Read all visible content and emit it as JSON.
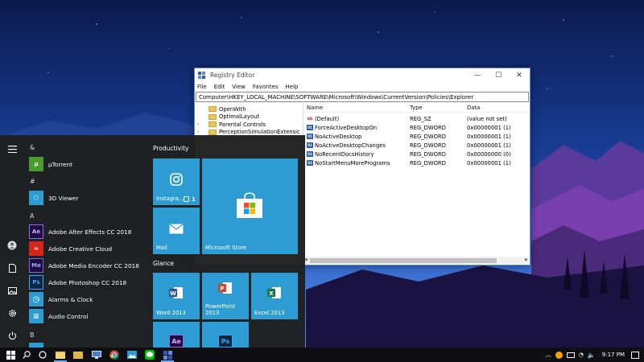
{
  "registry_editor": {
    "title": "Registry Editor",
    "menu": [
      "File",
      "Edit",
      "View",
      "Favorites",
      "Help"
    ],
    "address": "Computer\\HKEY_LOCAL_MACHINE\\SOFTWARE\\Microsoft\\Windows\\CurrentVersion\\Policies\\Explorer",
    "tree": [
      {
        "label": "OpenWith",
        "expandable": false
      },
      {
        "label": "OptimalLayout",
        "expandable": false
      },
      {
        "label": "Parental Controls",
        "expandable": true
      },
      {
        "label": "PerceptionSimulationExtensic",
        "expandable": true
      }
    ],
    "columns": {
      "name": "Name",
      "type": "Type",
      "data": "Data"
    },
    "values": [
      {
        "name": "(Default)",
        "type": "REG_SZ",
        "data": "(value not set)",
        "kind": "sz"
      },
      {
        "name": "ForceActiveDesktopOn",
        "type": "REG_DWORD",
        "data": "0x00000001 (1)",
        "kind": "dword"
      },
      {
        "name": "NoActiveDesktop",
        "type": "REG_DWORD",
        "data": "0x00000001 (1)",
        "kind": "dword"
      },
      {
        "name": "NoActiveDesktopChanges",
        "type": "REG_DWORD",
        "data": "0x00000001 (1)",
        "kind": "dword"
      },
      {
        "name": "NoRecentDocsHistory",
        "type": "REG_DWORD",
        "data": "0x00000000 (0)",
        "kind": "dword"
      },
      {
        "name": "NoStartMenuMorePrograms",
        "type": "REG_DWORD",
        "data": "0x00000001 (1)",
        "kind": "dword"
      }
    ]
  },
  "start_menu": {
    "sections": [
      {
        "letter": "&",
        "apps": [
          {
            "label": "µTorrent",
            "icon": "utorrent-icon",
            "color": "#4a9b2e",
            "glyph": "µ"
          }
        ]
      },
      {
        "letter": "#",
        "apps": [
          {
            "label": "3D Viewer",
            "icon": "3d-viewer-icon",
            "color": "#2d9cd3",
            "glyph": "⬡"
          }
        ]
      },
      {
        "letter": "A",
        "apps": [
          {
            "label": "Adobe After Effects CC 2018",
            "icon": "after-effects-icon",
            "color": "#1f0c45",
            "glyph": "Ae"
          },
          {
            "label": "Adobe Creative Cloud",
            "icon": "creative-cloud-icon",
            "color": "#d4261d",
            "glyph": "∞"
          },
          {
            "label": "Adobe Media Encoder CC 2018",
            "icon": "media-encoder-icon",
            "color": "#1f0c45",
            "glyph": "Me"
          },
          {
            "label": "Adobe Photoshop CC 2018",
            "icon": "photoshop-icon",
            "color": "#0b2540",
            "glyph": "Ps"
          },
          {
            "label": "Alarms & Clock",
            "icon": "alarm-clock-icon",
            "color": "#2d9cd3",
            "glyph": "◷"
          },
          {
            "label": "Audio Control",
            "icon": "audio-control-icon",
            "color": "#2d9cd3",
            "glyph": "≡"
          }
        ]
      },
      {
        "letter": "B",
        "apps": []
      }
    ],
    "groups": {
      "productivity": "Productivity",
      "glance": "Glance"
    },
    "tiles": {
      "instagram": {
        "label": "Instagra...",
        "badge": "1"
      },
      "store": {
        "label": "Microsoft Store"
      },
      "mail": {
        "label": "Mail"
      },
      "word": {
        "label": "Word 2013"
      },
      "powerpoint": {
        "label": "PowerPoint 2013"
      },
      "excel": {
        "label": "Excel 2013"
      },
      "after_effects": {
        "glyph": "Ae"
      },
      "photoshop": {
        "glyph": "Ps"
      }
    }
  },
  "taskbar": {
    "time": "9:17 PM",
    "icons": [
      "windows-start-icon",
      "search-icon",
      "task-view-icon",
      "file-explorer-icon",
      "computer-icon",
      "chrome-icon",
      "photos-icon",
      "line-icon",
      "regedit-icon"
    ]
  }
}
